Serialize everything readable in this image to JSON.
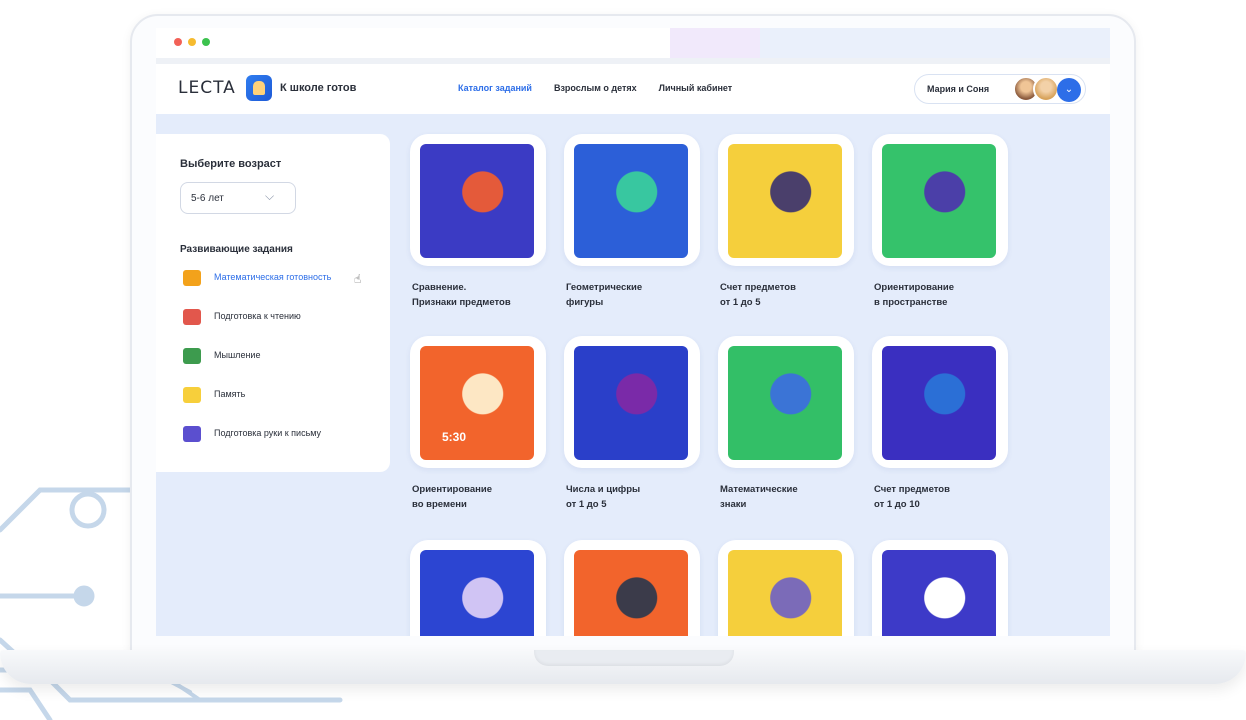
{
  "colors": {
    "accent": "#2d6ee8",
    "page_bg": "#e4ecfb",
    "text": "#2a2f3a"
  },
  "browser": {
    "window_dots": [
      "#f26157",
      "#f6bb2f",
      "#3cc24e"
    ]
  },
  "header": {
    "logo_text": "LECTA",
    "logo_icon": "lecta-app-icon",
    "product_name": "К школе готов",
    "nav": [
      {
        "label": "Каталог заданий",
        "active": true
      },
      {
        "label": "Взрослым о детях",
        "active": false
      },
      {
        "label": "Личный кабинет",
        "active": false
      }
    ],
    "profile": {
      "name": "Мария и Соня",
      "toggle_icon": "chevron-down-icon",
      "toggle_glyph": "⌄"
    }
  },
  "sidebar": {
    "age_title": "Выберите возраст",
    "age_value": "5-6 лет",
    "age_chevron": "⌵",
    "section_title": "Развивающие задания",
    "items": [
      {
        "label": "Математическая готовность",
        "icon": "blocks-icon",
        "color": "#f3a21b",
        "active": true
      },
      {
        "label": "Подготовка к чтению",
        "icon": "book-icon",
        "color": "#e2574c",
        "active": false
      },
      {
        "label": "Мышление",
        "icon": "puzzle-icon",
        "color": "#3d9b4e",
        "active": false
      },
      {
        "label": "Память",
        "icon": "lightbulb-icon",
        "color": "#f7cf3b",
        "active": false
      },
      {
        "label": "Подготовка руки к письму",
        "icon": "cube-icon",
        "color": "#5b4fcf",
        "active": false
      }
    ]
  },
  "cards": [
    {
      "title_lines": [
        "Сравнение.",
        "Признаки предметов"
      ],
      "bg": "#3b3bc4",
      "accent": "#e45a3a",
      "art": "planet-comparison"
    },
    {
      "title_lines": [
        "Геометрические",
        "фигуры"
      ],
      "bg": "#2c5fd8",
      "accent": "#38c7a0",
      "art": "geometric-planets"
    },
    {
      "title_lines": [
        "Счет предметов",
        "от 1 до 5"
      ],
      "bg": "#f5cf3c",
      "accent": "#4a3f6b",
      "art": "counting-asteroids"
    },
    {
      "title_lines": [
        "Ориентирование",
        "в пространстве"
      ],
      "bg": "#35c26b",
      "accent": "#4b3fa8",
      "art": "space-orientation"
    },
    {
      "title_lines": [
        "Ориентирование",
        "во времени"
      ],
      "bg": "#f2642c",
      "accent": "#fde7c4",
      "art": "sun-clock",
      "overlay_text": "5:30"
    },
    {
      "title_lines": [
        "Числа и цифры",
        "от 1 до 5"
      ],
      "bg": "#2a3fc9",
      "accent": "#7a2aa8",
      "art": "numbers-nebula"
    },
    {
      "title_lines": [
        "Математические",
        "знаки"
      ],
      "bg": "#33bf67",
      "accent": "#3b74d6",
      "art": "math-signs"
    },
    {
      "title_lines": [
        "Счет предметов",
        "от 1 до 10"
      ],
      "bg": "#3a2fc0",
      "accent": "#2b6fd6",
      "art": "counting-to-ten"
    },
    {
      "title_lines": [],
      "bg": "#2c45d2",
      "accent": "#d0c4f4",
      "art": "moon-plus-minus"
    },
    {
      "title_lines": [],
      "bg": "#f2642c",
      "accent": "#3b3b4a",
      "art": "rockets-one"
    },
    {
      "title_lines": [],
      "bg": "#f5cf3c",
      "accent": "#7b6bb8",
      "art": "spaceship-six"
    },
    {
      "title_lines": [],
      "bg": "#3d3ac8",
      "accent": "#ffffff",
      "art": "constellations"
    }
  ]
}
